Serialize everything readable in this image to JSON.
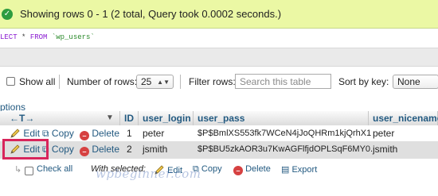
{
  "banner": {
    "message": "Showing rows 0 - 1 (2 total, Query took 0.0002 seconds.)",
    "ok_icon": "✓"
  },
  "sql": {
    "keyword_partial": "LECT",
    "star": " * ",
    "from": "FROM ",
    "table": "`wp_users`"
  },
  "toolbar": {
    "show_all": "Show all",
    "number_of_rows_label": "Number of rows:",
    "number_of_rows_value": "25",
    "filter_label": "Filter rows:",
    "filter_placeholder": "Search this table",
    "sort_label": "Sort by key:",
    "sort_value": "None"
  },
  "options_label": "ptions",
  "columns": {
    "id": "ID",
    "user_login": "user_login",
    "user_pass": "user_pass",
    "user_nicename": "user_nicename"
  },
  "actions": {
    "edit": "Edit",
    "copy": "Copy",
    "delete": "Delete"
  },
  "rows": [
    {
      "id": "1",
      "user_login": "peter",
      "user_pass": "$P$BmlXS553fk7WCeN4jJoQHRm1kjQrhX1",
      "user_nicename": "peter"
    },
    {
      "id": "2",
      "user_login": "jsmith",
      "user_pass": "$P$BU5zkAOR3u7KwAGFlfjdOPLSqF6MY0.",
      "user_nicename": "jsmith"
    }
  ],
  "footer": {
    "check_all": "Check all",
    "with_selected": "With selected:",
    "edit": "Edit",
    "copy": "Copy",
    "delete": "Delete",
    "export": "Export"
  },
  "watermark": "wpbeginner.com",
  "colors": {
    "banner_bg": "#ebf8a4",
    "link": "#235a81",
    "highlight_box": "#d8255b",
    "sql_keyword": "#8a1bd1",
    "sql_table": "#2a8a2a"
  }
}
